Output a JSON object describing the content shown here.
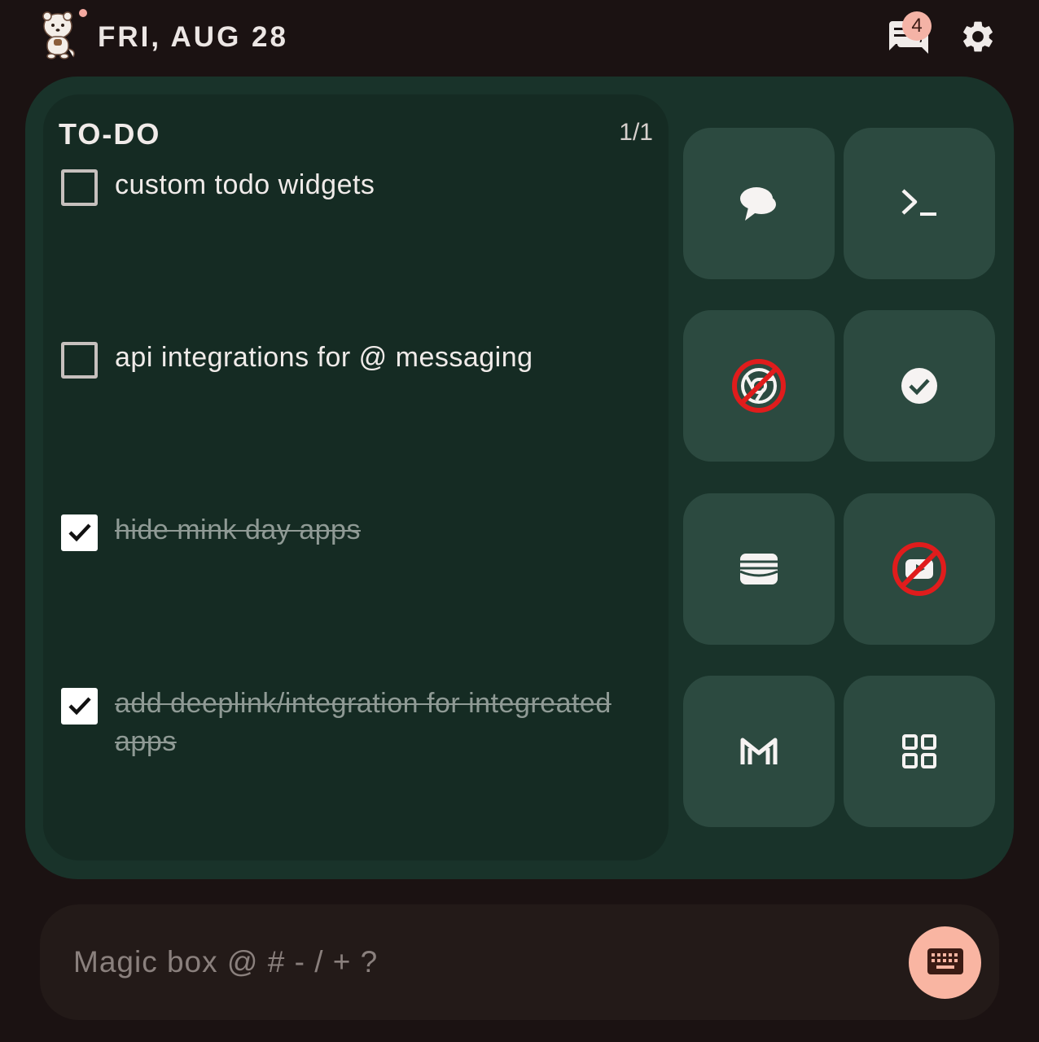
{
  "header": {
    "date": "FRI, AUG 28",
    "notification_count": "4"
  },
  "todo": {
    "title": "TO-DO",
    "page": "1/1",
    "items": [
      {
        "text": "custom todo widgets",
        "checked": false
      },
      {
        "text": "api integrations for @ messaging",
        "checked": false
      },
      {
        "text": "hide mink day apps",
        "checked": true
      },
      {
        "text": "add deeplink/integration for integreated apps",
        "checked": true
      }
    ]
  },
  "app_tiles": [
    {
      "icon": "chat-bubbles-icon"
    },
    {
      "icon": "terminal-icon"
    },
    {
      "icon": "chrome-blocked-icon"
    },
    {
      "icon": "check-circle-icon"
    },
    {
      "icon": "wallet-icon"
    },
    {
      "icon": "youtube-blocked-icon"
    },
    {
      "icon": "gmail-icon"
    },
    {
      "icon": "app-grid-icon"
    }
  ],
  "magic_box": {
    "placeholder": "Magic box @ # - / + ?",
    "value": ""
  },
  "colors": {
    "background": "#1b1212",
    "card": "#19332a",
    "todo_panel": "#152b23",
    "tile": "#2c4a40",
    "accent": "#f9b5a2",
    "blocked_red": "#e01c1c"
  }
}
